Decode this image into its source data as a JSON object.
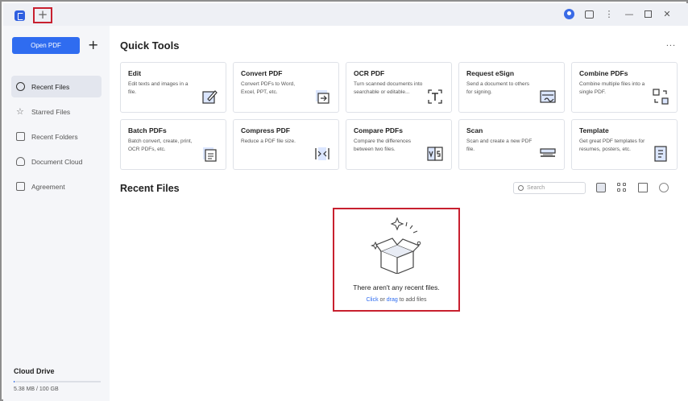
{
  "titlebar": {
    "logo_icon": "app-logo-icon",
    "new_tab_label": "+",
    "icons": [
      "avatar-icon",
      "message-icon",
      "more-vertical-icon",
      "minimize-icon",
      "maximize-icon",
      "close-icon"
    ],
    "more_glyph": "⋮",
    "minimize_glyph": "—",
    "close_glyph": "✕"
  },
  "sidebar": {
    "open_pdf_label": "Open PDF",
    "add_label": "+",
    "items": [
      {
        "label": "Recent Files",
        "icon": "clock-icon",
        "active": true
      },
      {
        "label": "Starred Files",
        "icon": "star-icon",
        "active": false
      },
      {
        "label": "Recent Folders",
        "icon": "folder-icon",
        "active": false
      },
      {
        "label": "Document Cloud",
        "icon": "cloud-icon",
        "active": false
      },
      {
        "label": "Agreement",
        "icon": "agreement-icon",
        "active": false
      }
    ],
    "star_glyph": "☆",
    "cloud_drive_label": "Cloud Drive",
    "storage_text": "5.38 MB / 100 GB",
    "storage_used_fraction": 5e-05
  },
  "main": {
    "quick_tools_title": "Quick Tools",
    "more_label": "...",
    "tools": [
      {
        "title": "Edit",
        "desc": "Edit texts and images in a file.",
        "icon": "edit-icon"
      },
      {
        "title": "Convert PDF",
        "desc": "Convert PDFs to Word, Excel, PPT, etc.",
        "icon": "convert-icon"
      },
      {
        "title": "OCR PDF",
        "desc": "Turn scanned documents into searchable or editable...",
        "icon": "ocr-icon"
      },
      {
        "title": "Request eSign",
        "desc": "Send a document to others for signing.",
        "icon": "esign-icon"
      },
      {
        "title": "Combine PDFs",
        "desc": "Combine multiple files into a single PDF.",
        "icon": "combine-icon"
      },
      {
        "title": "Batch PDFs",
        "desc": "Batch convert, create, print, OCR PDFs, etc.",
        "icon": "batch-icon"
      },
      {
        "title": "Compress PDF",
        "desc": "Reduce a PDF file size.",
        "icon": "compress-icon"
      },
      {
        "title": "Compare PDFs",
        "desc": "Compare the differences between two files.",
        "icon": "compare-icon"
      },
      {
        "title": "Scan",
        "desc": "Scan and create a new PDF file.",
        "icon": "scan-icon"
      },
      {
        "title": "Template",
        "desc": "Get great PDF templates for resumes, posters, etc.",
        "icon": "template-icon"
      }
    ],
    "recent_files_title": "Recent Files",
    "search_placeholder": "Search",
    "view_icons": [
      "list-view-icon",
      "grid-view-icon",
      "trash-icon",
      "refresh-icon"
    ],
    "empty": {
      "message": "There aren't any recent files.",
      "click_label": "Click",
      "or_label": " or ",
      "drag_label": "drag",
      "suffix_label": " to add files"
    },
    "accent_color": "#2f6cf0",
    "highlight_color": "#c8202f"
  }
}
